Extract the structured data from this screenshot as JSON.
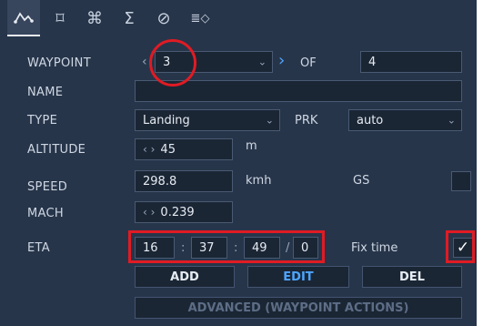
{
  "tabs": [
    {
      "name": "route-icon",
      "glyph": "",
      "active": true
    },
    {
      "name": "satellite-icon",
      "glyph": "⌑"
    },
    {
      "name": "command-icon",
      "glyph": "⌘"
    },
    {
      "name": "sigma-icon",
      "glyph": "Σ"
    },
    {
      "name": "disabled-icon",
      "glyph": "⊘"
    },
    {
      "name": "list-diamond-icon",
      "glyph": "≣◇"
    }
  ],
  "form": {
    "waypoint_label": "WAYPOINT",
    "waypoint_value": "3",
    "of_label": "OF",
    "of_value": "4",
    "name_label": "NAME",
    "name_value": "",
    "type_label": "TYPE",
    "type_value": "Landing",
    "prk_label": "PRK",
    "prk_value": "auto",
    "altitude_label": "ALTITUDE",
    "altitude_value": "45",
    "altitude_unit": "m",
    "speed_label": "SPEED",
    "speed_value": "298.8",
    "speed_unit": "kmh",
    "gs_label": "GS",
    "mach_label": "MACH",
    "mach_value": "0.239",
    "eta_label": "ETA",
    "eta_hours": "16",
    "eta_minutes": "37",
    "eta_seconds": "49",
    "eta_frac": "0",
    "eta_sep_colon": ":",
    "eta_sep_slash": "/",
    "fix_time_label": "Fix time",
    "fix_time_checked": true
  },
  "buttons": {
    "add": "ADD",
    "edit": "EDIT",
    "del": "DEL",
    "advanced": "ADVANCED (WAYPOINT ACTIONS)"
  },
  "colors": {
    "panel": "#27354a",
    "field": "#1b2635",
    "accent": "#4ea6ff",
    "highlight": "#e01b24"
  }
}
